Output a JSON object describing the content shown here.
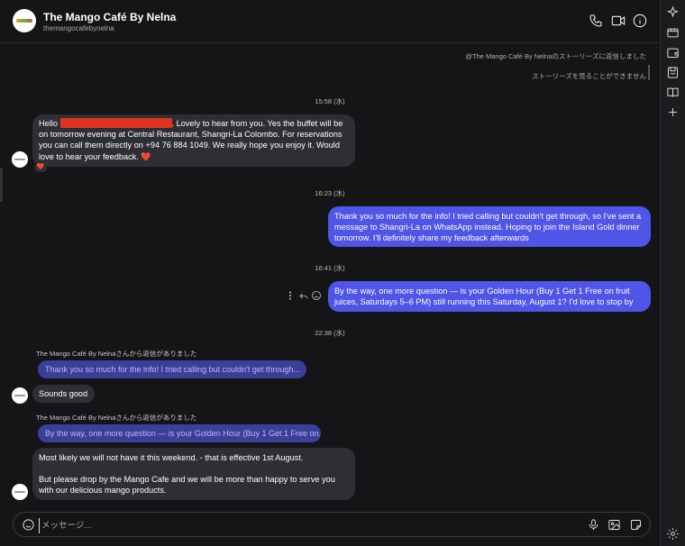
{
  "header": {
    "title": "The Mango Café By Nelna",
    "handle": "themangocafebynelna"
  },
  "story_reply": {
    "line1": "@The Mango Café By Nelnaのストーリーズに返信しました",
    "line2": "ストーリーズを見ることができません"
  },
  "timestamps": [
    "15:58 (水)",
    "16:23 (水)",
    "16:41 (水)",
    "22:38 (水)"
  ],
  "messages": {
    "m1_before": "Hello ",
    "m1_after": ". Lovely to hear from you. Yes the buffet will be on tomorrow evening at Central Restaurant, Shangri-La Colombo. For reservations you can call them directly on +94 76 884 1049. We really hope you enjoy it. Would love to hear your feedback. ❤️",
    "m1_reaction": "❤️",
    "m2": "Thank you so much for the info! I tried calling but couldn't get through, so I've sent a message to Shangri-La on WhatsApp instead. Hoping to join the Island Gold dinner tomorrow. I'll definitely share my feedback afterwards",
    "m3": "By the way, one more question — is your Golden Hour (Buy 1 Get 1 Free on fruit juices, Saturdays 5–6 PM) still running this Saturday, August 1? I'd love to stop by",
    "reply1_label": "The Mango Café By Nelnaさんから返信がありました",
    "reply1_quote": "Thank you so much for the info! I tried calling but couldn't get through...",
    "reply1_text": "Sounds good",
    "reply2_label": "The Mango Café By Nelnaさんから返信がありました",
    "reply2_quote": "By the way, one more question — is your Golden Hour (Buy 1 Get 1 Free on...",
    "reply2_p1": "Most likely we will not have it this weekend. - that is effective 1st August.",
    "reply2_p2": "But please drop by the Mango Cafe and we will be more than happy to serve you with our delicious mango products."
  },
  "composer": {
    "placeholder": "メッセージ..."
  },
  "colors": {
    "outgoing_bubble": "#4f55e6",
    "incoming_bubble": "#2e2f33",
    "quote_bubble": "#3a3f9a",
    "redaction": "#e0321e"
  },
  "icons": {
    "header": [
      "phone-icon",
      "video-icon",
      "info-icon"
    ],
    "rail": [
      "sparkle-icon",
      "reels-icon",
      "wallet-icon",
      "save-icon",
      "book-icon",
      "plus-icon",
      "settings-icon"
    ],
    "composer": [
      "emoji-icon",
      "mic-icon",
      "image-icon",
      "sticker-icon"
    ],
    "message_actions": [
      "more-icon",
      "reply-icon",
      "react-icon"
    ]
  }
}
